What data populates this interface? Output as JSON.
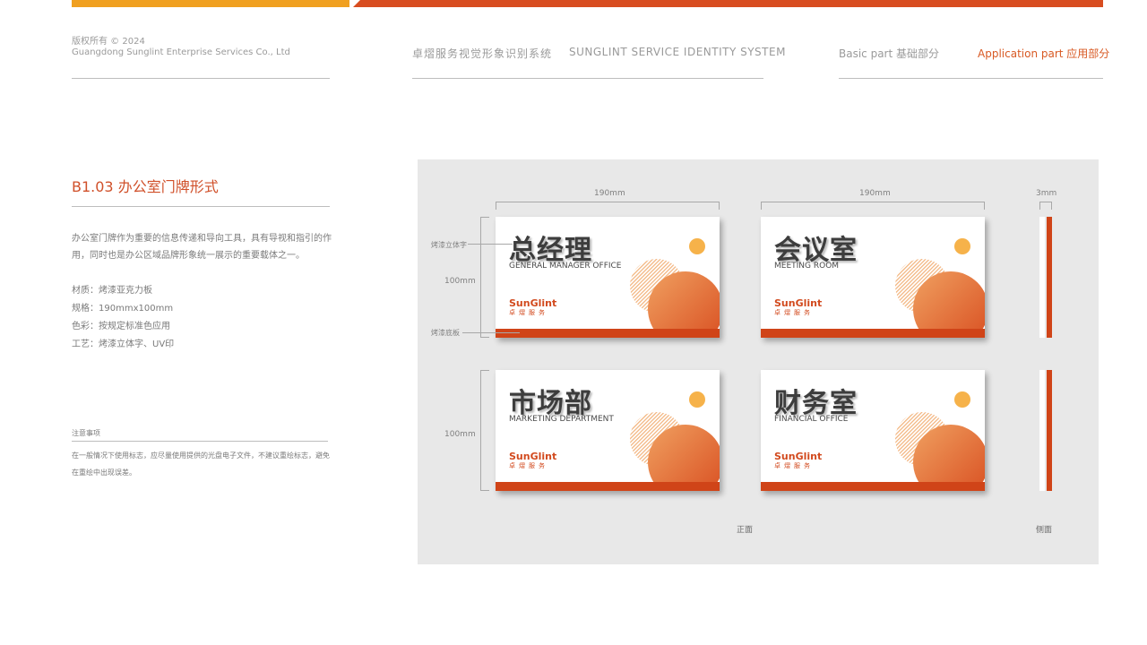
{
  "header": {
    "copyright": "版权所有 © 2024",
    "company": "Guangdong Sunglint Enterprise Services Co., Ltd",
    "system_cn": "卓熠服务视觉形象识别系统",
    "system_en": "SUNGLINT SERVICE IDENTITY SYSTEM",
    "nav_basic": "Basic part 基础部分",
    "nav_application": "Application part 应用部分"
  },
  "colors": {
    "accent": "#d04418",
    "secondary": "#f0a020"
  },
  "section": {
    "title": "B1.03 办公室门牌形式",
    "description": "办公室门牌作为重要的信息传递和导向工具，具有导视和指引的作用，同时也是办公区域品牌形象统一展示的重要载体之一。",
    "specs": [
      "材质：烤漆亚克力板",
      "规格：190mmx100mm",
      "色彩：按规定标准色应用",
      "工艺：烤漆立体字、UV印"
    ]
  },
  "note": {
    "title": "注意事项",
    "text": "在一般情况下使用标志，应尽量使用提供的光盘电子文件，不建议重绘标志，避免在重绘中出现误差。"
  },
  "diagram": {
    "width_label": "190mm",
    "height_label": "100mm",
    "thickness_label": "3mm",
    "callout_text": "烤漆立体字",
    "callout_base": "烤漆底板",
    "caption_front": "正面",
    "caption_side": "侧面"
  },
  "logo": {
    "en": "SunGlint",
    "cn": "卓熠服务"
  },
  "plates": [
    {
      "title": "总经理",
      "subtitle": "GENERAL MANAGER OFFICE"
    },
    {
      "title": "会议室",
      "subtitle": "MEETING ROOM"
    },
    {
      "title": "市场部",
      "subtitle": "MARKETING DEPARTMENT"
    },
    {
      "title": "财务室",
      "subtitle": "FINANCIAL OFFICE"
    }
  ]
}
